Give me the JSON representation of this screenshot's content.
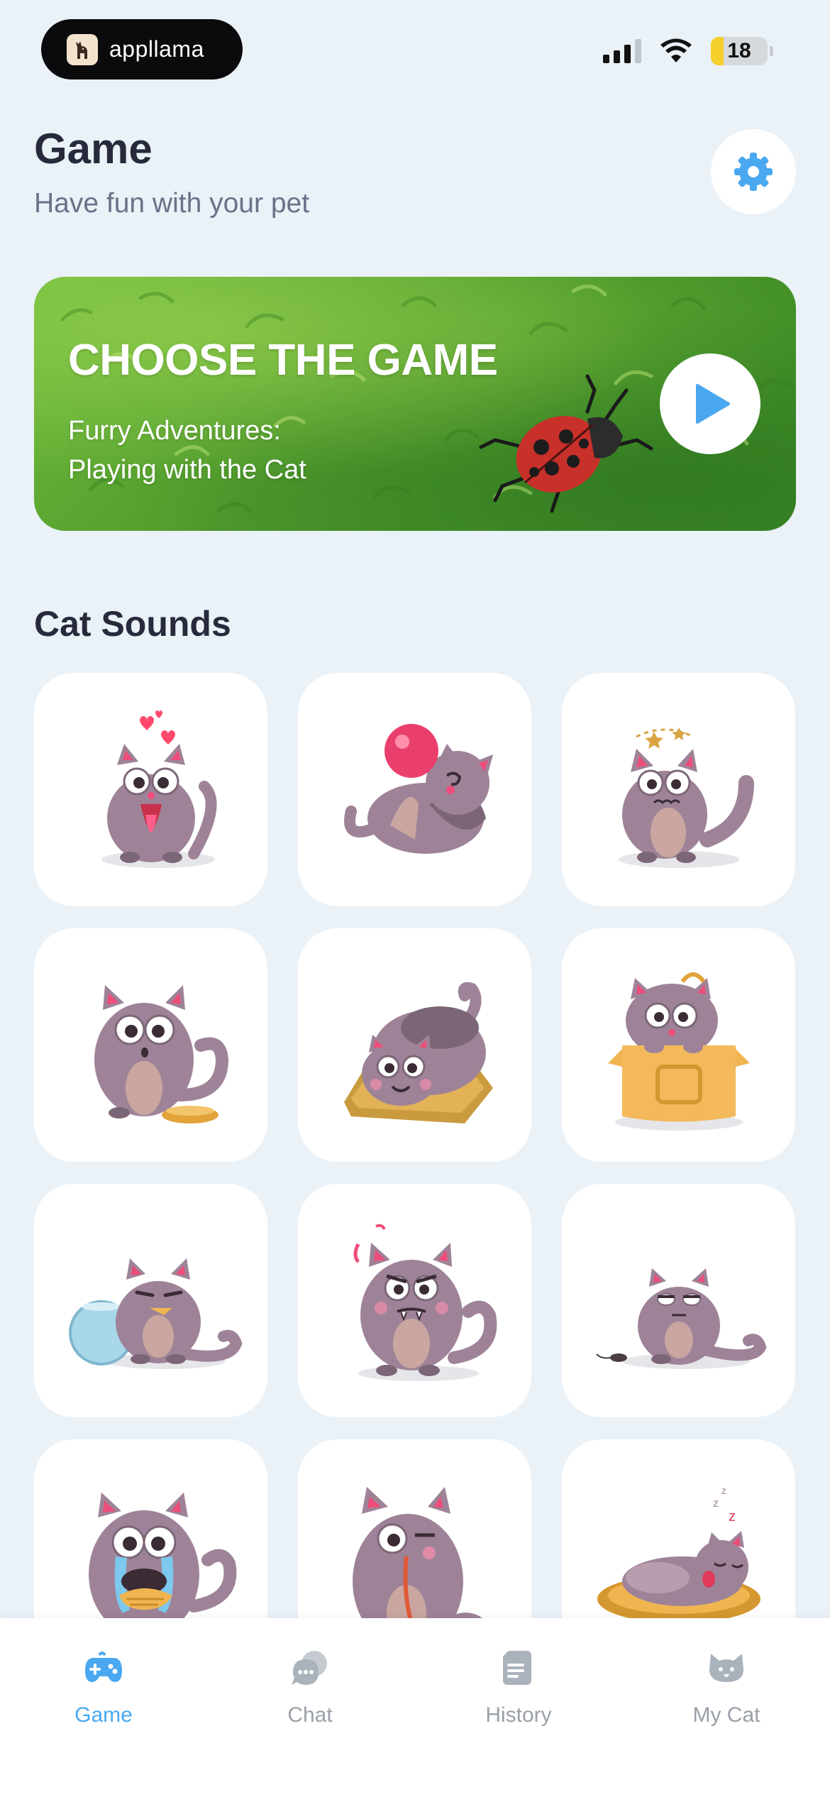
{
  "status_bar": {
    "brand": "appllama",
    "battery": "18"
  },
  "header": {
    "title": "Game",
    "subtitle": "Have fun with your pet"
  },
  "banner": {
    "title": "CHOOSE THE GAME",
    "subtitle": "Furry Adventures:\n Playing with the Cat"
  },
  "section": {
    "title": "Cat Sounds"
  },
  "tabs": [
    {
      "label": "Game",
      "icon": "gamepad-icon",
      "active": true
    },
    {
      "label": "Chat",
      "icon": "chat-bubbles-icon",
      "active": false
    },
    {
      "label": "History",
      "icon": "document-icon",
      "active": false
    },
    {
      "label": "My Cat",
      "icon": "cat-face-icon",
      "active": false
    }
  ],
  "colors": {
    "accent": "#4aa8f0",
    "background": "#eaf1f7",
    "cat": "#9e8398"
  }
}
